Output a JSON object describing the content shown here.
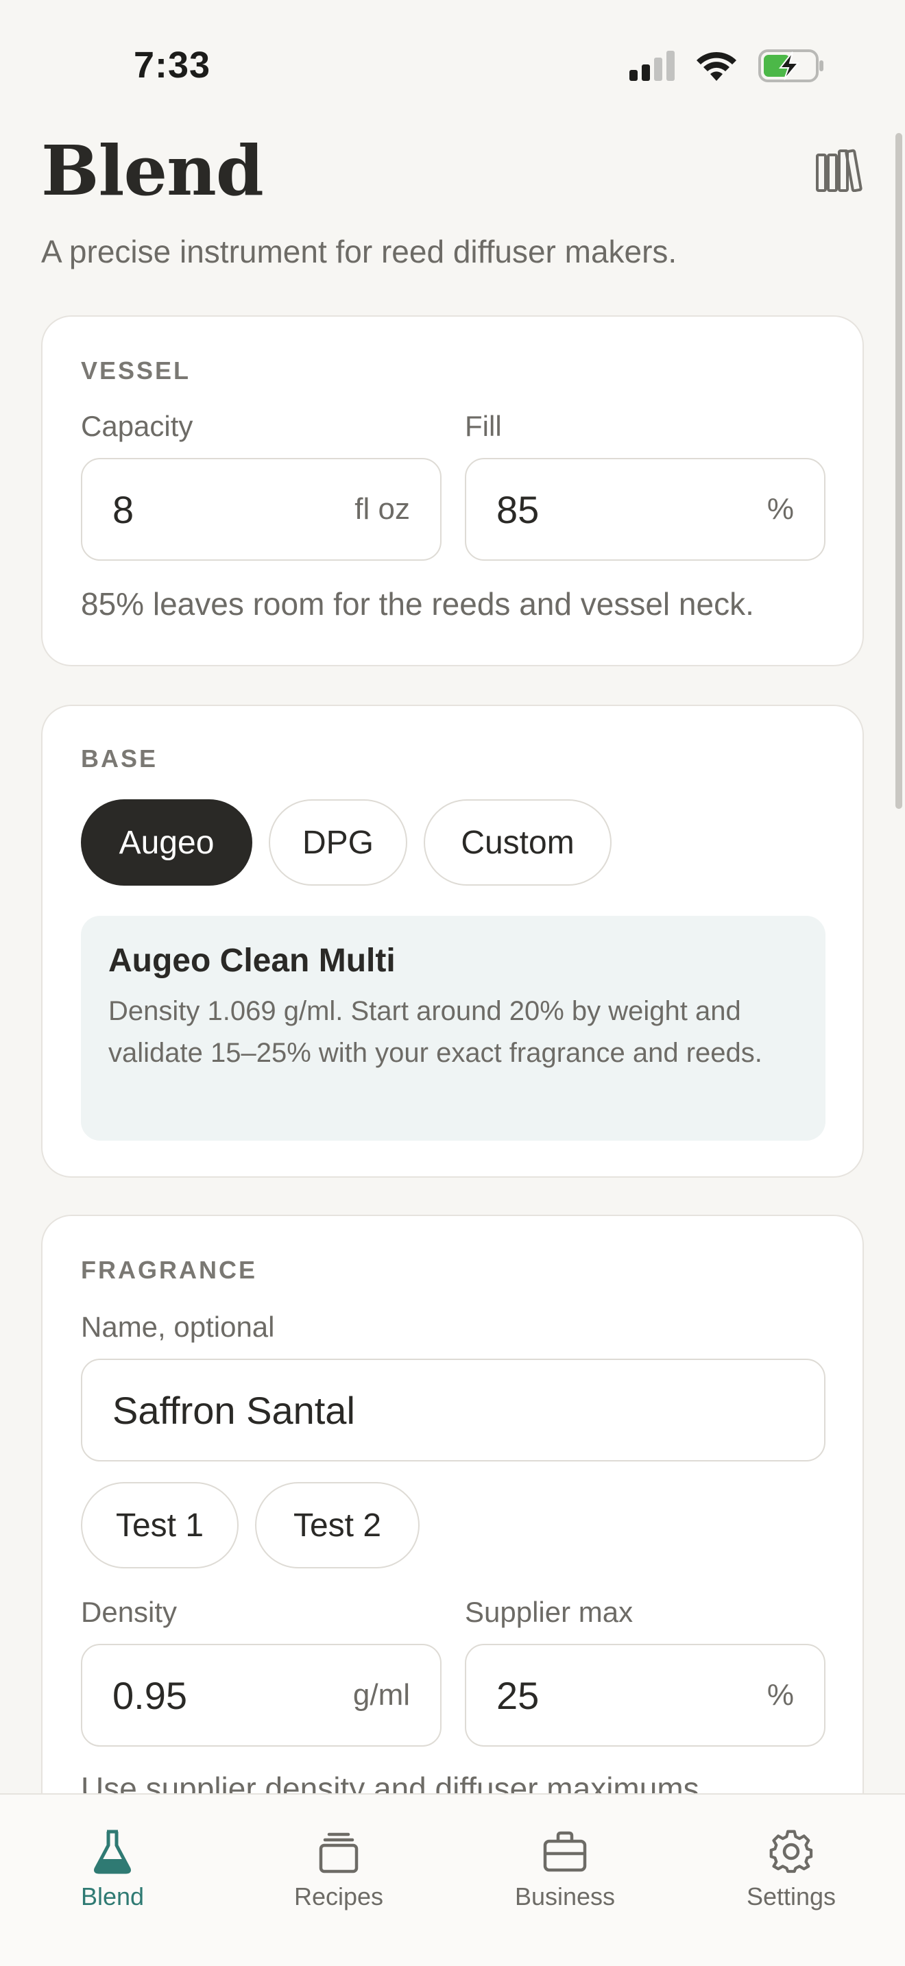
{
  "status_bar": {
    "time": "7:33"
  },
  "header": {
    "title": "Blend",
    "subtitle": "A precise instrument for reed diffuser makers.",
    "library_icon": "bookshelf-icon"
  },
  "vessel": {
    "section_label": "VESSEL",
    "capacity_label": "Capacity",
    "capacity_value": "8",
    "capacity_unit": "fl oz",
    "fill_label": "Fill",
    "fill_value": "85",
    "fill_unit": "%",
    "helper": "85% leaves room for the reeds and vessel neck."
  },
  "base": {
    "section_label": "BASE",
    "options": [
      "Augeo",
      "DPG",
      "Custom"
    ],
    "selected": "Augeo",
    "info_title": "Augeo Clean Multi",
    "info_body": "Density 1.069 g/ml. Start around 20% by weight and validate 15–25% with your exact fragrance and reeds."
  },
  "fragrance": {
    "section_label": "FRAGRANCE",
    "name_label": "Name, optional",
    "name_value": "Saffron Santal",
    "tests": [
      "Test 1",
      "Test 2"
    ],
    "density_label": "Density",
    "density_value": "0.95",
    "density_unit": "g/ml",
    "supplier_max_label": "Supplier max",
    "supplier_max_value": "25",
    "supplier_max_unit": "%",
    "helper_partial": "Use supplier density and diffuser maximums."
  },
  "tabbar": {
    "active": "Blend",
    "accent_color": "#2f7a73",
    "tabs": [
      {
        "label": "Blend",
        "icon": "flask-icon"
      },
      {
        "label": "Recipes",
        "icon": "recipes-stack-icon"
      },
      {
        "label": "Business",
        "icon": "briefcase-icon"
      },
      {
        "label": "Settings",
        "icon": "gear-icon"
      }
    ]
  }
}
